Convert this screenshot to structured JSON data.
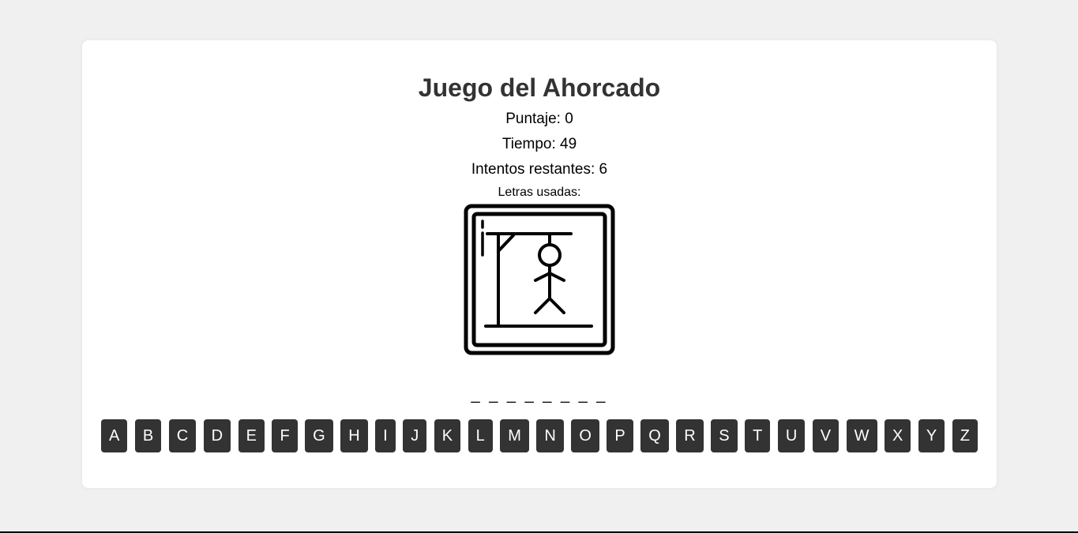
{
  "game": {
    "title": "Juego del Ahorcado",
    "score": "Puntaje: 0",
    "time": "Tiempo: 49",
    "remaining": "Intentos restantes: 6",
    "used_letters": "Letras usadas:",
    "word_display": "_ _ _ _ _ _ _ _"
  },
  "keyboard": {
    "keys": [
      "A",
      "B",
      "C",
      "D",
      "E",
      "F",
      "G",
      "H",
      "I",
      "J",
      "K",
      "L",
      "M",
      "N",
      "O",
      "P",
      "Q",
      "R",
      "S",
      "T",
      "U",
      "V",
      "W",
      "X",
      "Y",
      "Z"
    ]
  },
  "icons": {
    "hangman": "hangman-icon"
  },
  "colors": {
    "page_bg": "#f0f0f0",
    "card_bg": "#ffffff",
    "key_bg": "#333333",
    "key_text": "#ffffff",
    "title": "#333333"
  }
}
